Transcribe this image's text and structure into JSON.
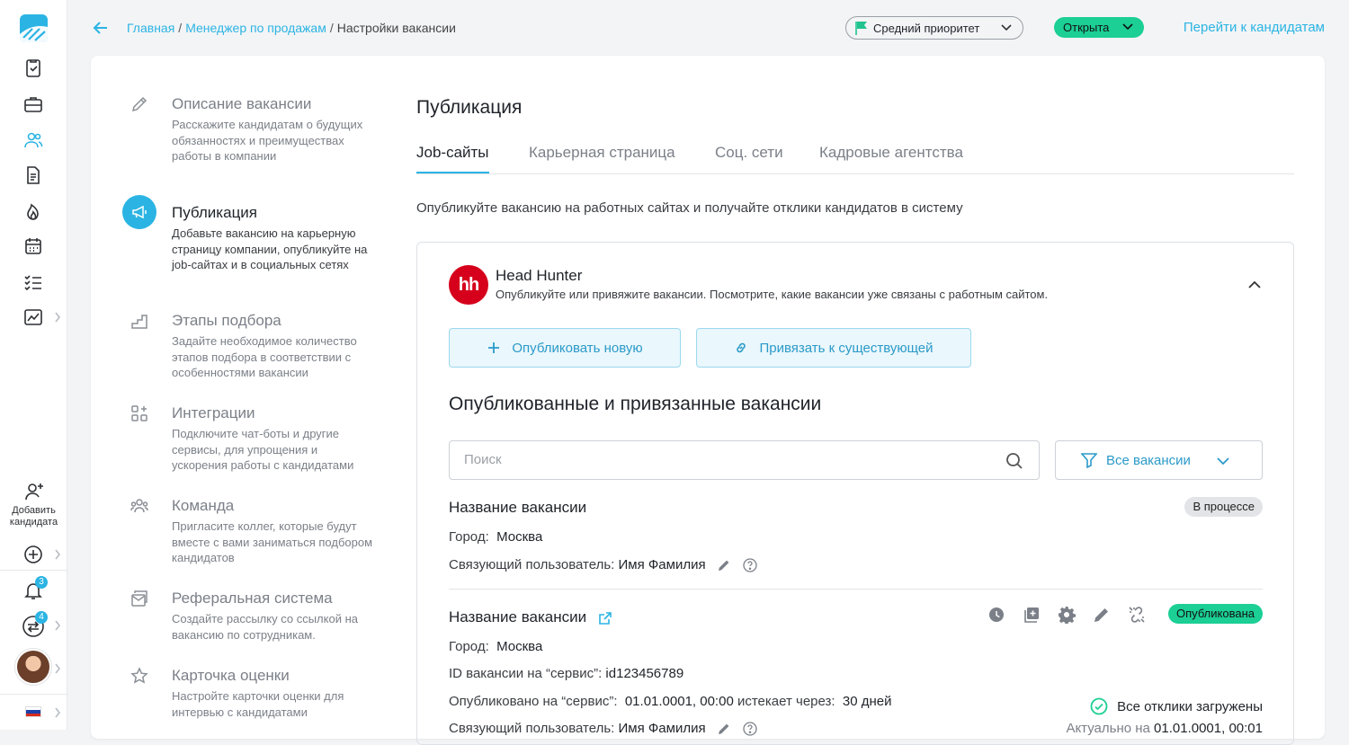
{
  "rail": {
    "add_candidate": "Добавить кандидата",
    "notifications_count": "3",
    "tasks_count": "4"
  },
  "breadcrumbs": {
    "home": "Главная",
    "vacancy": "Менеджер по продажам",
    "current": "Настройки вакансии",
    "separator": "/"
  },
  "header": {
    "priority": "Средний приоритет",
    "status": "Открыта",
    "go_to_candidates": "Перейти к кандидатам"
  },
  "steps": [
    {
      "title": "Описание вакансии",
      "desc": "Расскажите кандидатам о будущих обязанностях и преимуществах работы в компании",
      "icon": "pencil-icon"
    },
    {
      "title": "Публикация",
      "desc": "Добавьте вакансию на карьерную страницу компании, опубликуйте на job-сайтах и в социальных сетях",
      "icon": "megaphone-icon"
    },
    {
      "title": "Этапы подбора",
      "desc": "Задайте необходимое количество этапов подбора в соответствии с особенностями вакансии",
      "icon": "stairs-icon"
    },
    {
      "title": "Интеграции",
      "desc": "Подключите чат-боты и другие сервисы, для упрощения и ускорения работы с кандидатами",
      "icon": "puzzle-icon"
    },
    {
      "title": "Команда",
      "desc": "Пригласите коллег, которые будут вместе с вами заниматься подбором кандидатов",
      "icon": "team-icon"
    },
    {
      "title": "Реферальная система",
      "desc": "Создайте рассылку со ссылкой на вакансию по сотрудникам.",
      "icon": "mail-icon"
    },
    {
      "title": "Карточка оценки",
      "desc": "Настройте карточки оценки для интервью с кандидатами",
      "icon": "star-icon"
    }
  ],
  "main": {
    "title": "Публикация",
    "tabs": [
      {
        "label": "Job-сайты"
      },
      {
        "label": "Карьерная страница"
      },
      {
        "label": "Соц. сети"
      },
      {
        "label": "Кадровые агентства"
      }
    ],
    "lead": "Опубликуйте вакансию на работных сайтах и получайте отклики кандидатов в систему"
  },
  "provider": {
    "logo_text": "hh",
    "name": "Head Hunter",
    "desc": "Опубликуйте или привяжите вакансии. Посмотрите, какие вакансии уже связаны с работным сайтом.",
    "publish_new": "Опубликовать новую",
    "link_existing": "Привязать к существующей",
    "section_title": "Опубликованные и привязанные вакансии",
    "search_placeholder": "Поиск",
    "filter_label": "Все вакансии"
  },
  "vacancies": [
    {
      "title": "Название вакансии",
      "status": "В процессе",
      "city_label": "Город:",
      "city": "Москва",
      "user_label": "Связующий пользователь:",
      "user": "Имя Фамилия"
    },
    {
      "title": "Название вакансии",
      "status": "Опубликована",
      "city_label": "Город:",
      "city": "Москва",
      "id_label": "ID вакансии на “сервис”:",
      "id": "id123456789",
      "published_label": "Опубликовано на “сервис”:",
      "published": "01.01.0001, 00:00",
      "expires_label": "истекает через:",
      "expires": "30 дней",
      "user_label": "Связующий пользователь:",
      "user": "Имя Фамилия",
      "loaded": "Все отклики загружены",
      "actual_label": "Актуально на",
      "actual": "01.01.0001, 00:01"
    }
  ],
  "colors": {
    "accent": "#2bb4e3",
    "success": "#1ccf94",
    "hh_red": "#d6001c"
  }
}
